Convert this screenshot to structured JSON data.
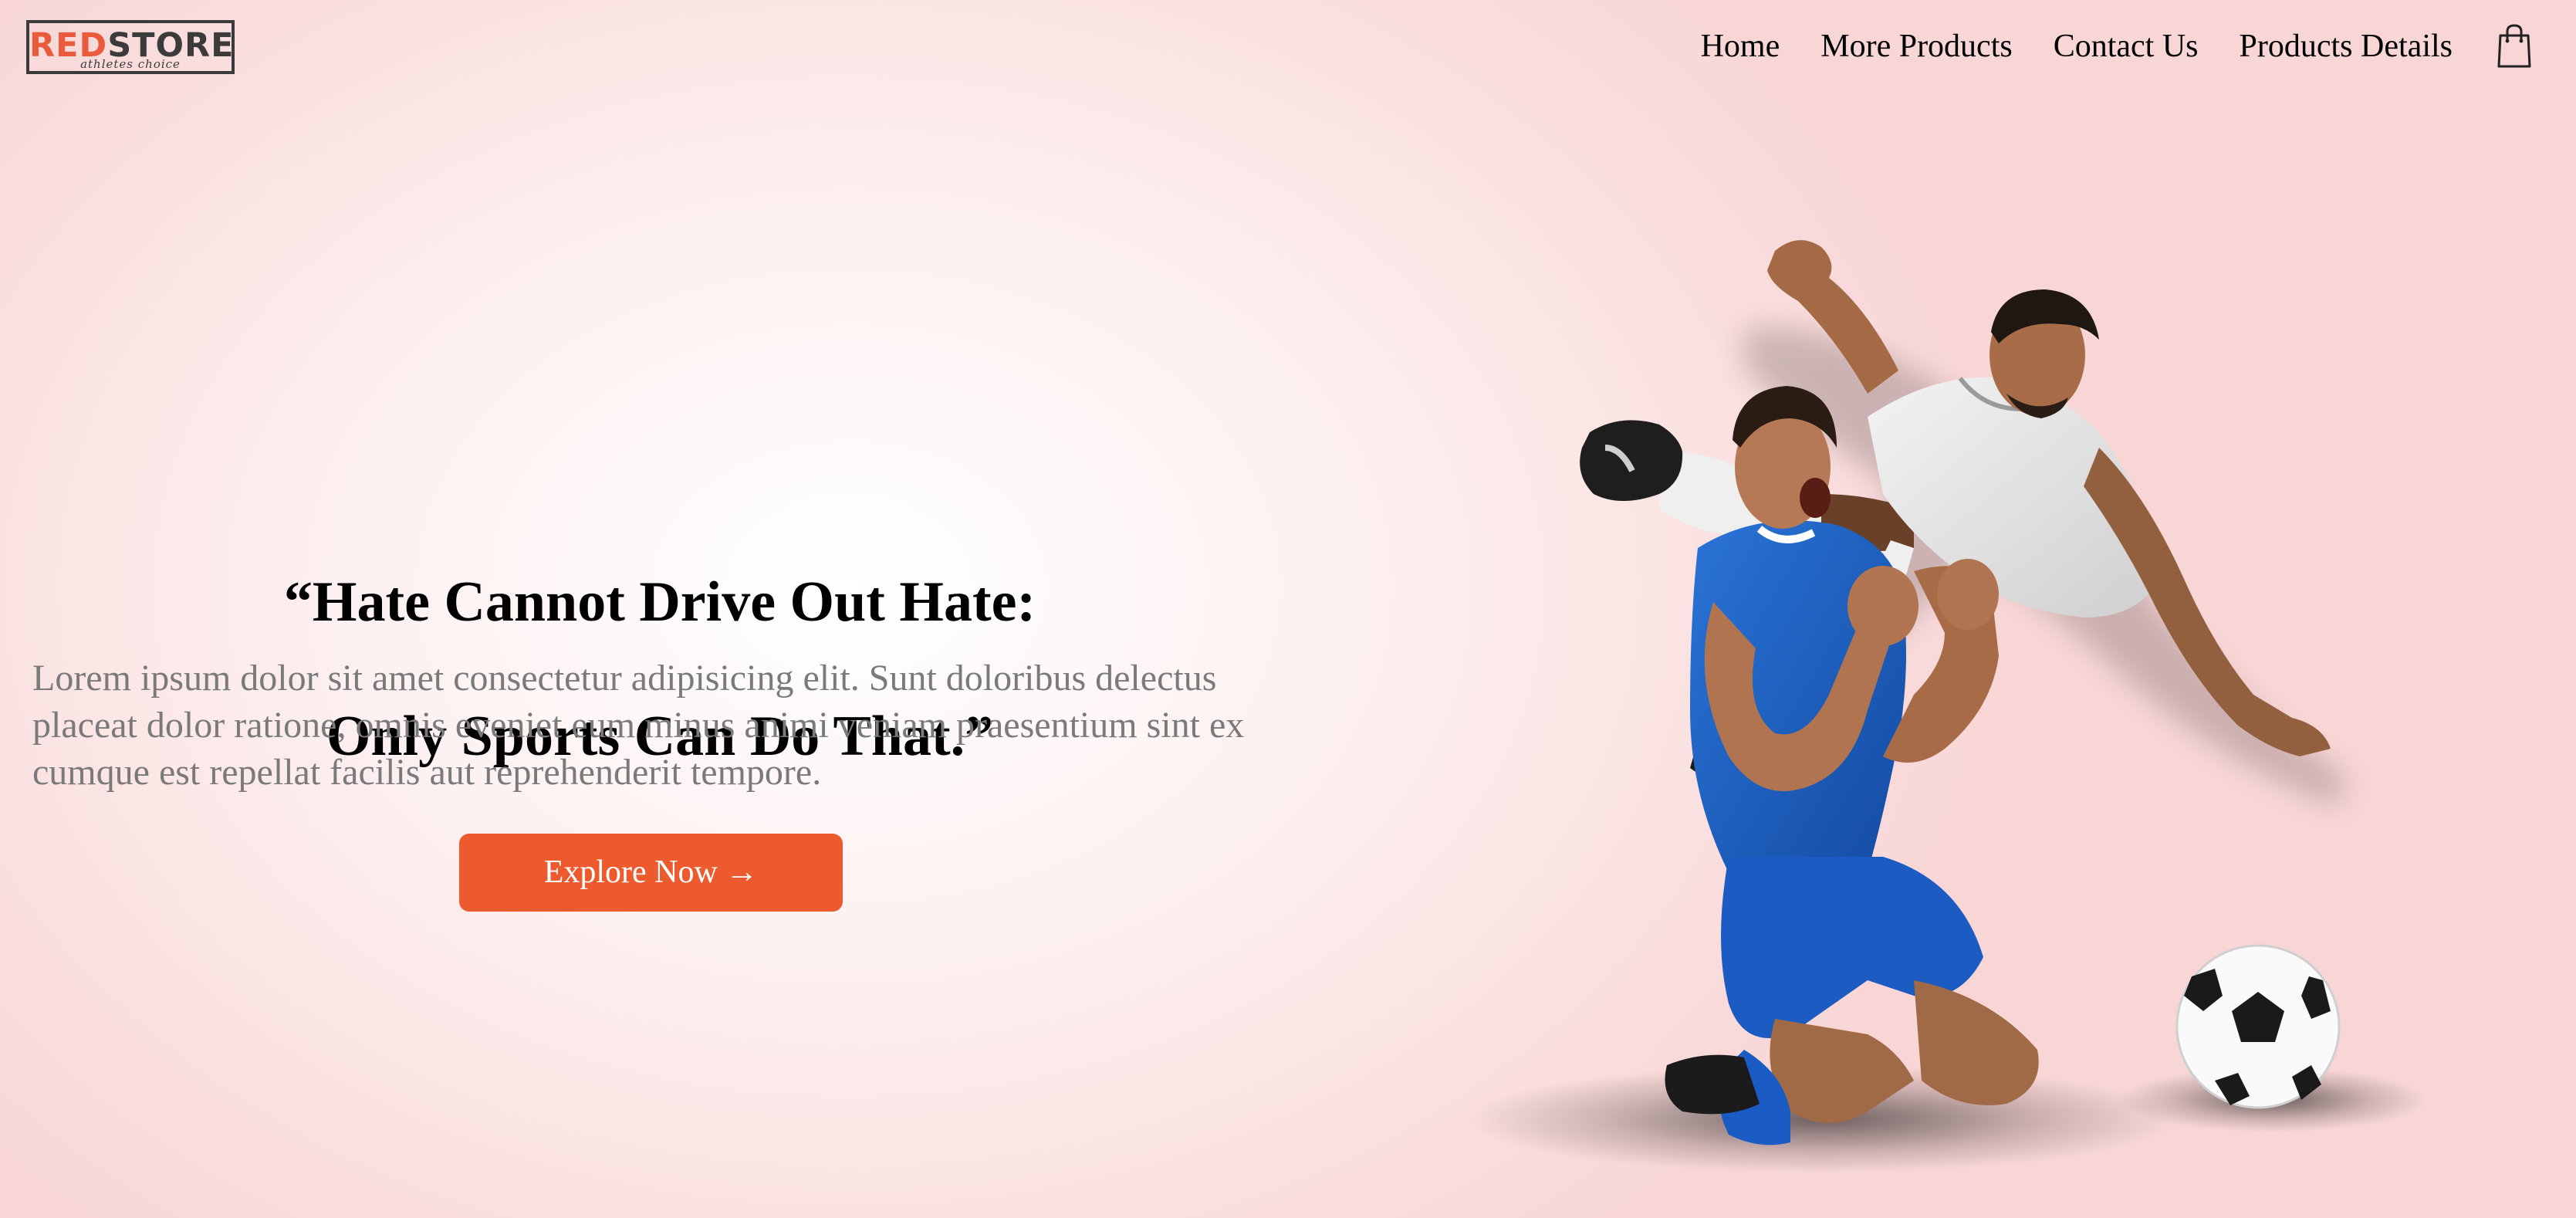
{
  "brand": {
    "name_red": "RED",
    "name_dark": "STORE",
    "tagline": "athletes choice"
  },
  "nav": {
    "items": [
      {
        "label": "Home"
      },
      {
        "label": "More Products"
      },
      {
        "label": "Contact Us"
      },
      {
        "label": "Products Details"
      }
    ],
    "cart_icon": "shopping-bag-icon"
  },
  "hero": {
    "headline_line1": "“Hate Cannot Drive Out Hate:",
    "headline_line2": "Only Sports Can Do That.”",
    "paragraph": "Lorem ipsum dolor sit amet consectetur adipisicing elit. Sunt doloribus delectus placeat dolor ratione, omnis eveniet eum minus animi veniam praesentium sint ex cumque est repellat facilis aut reprehenderit tempore.",
    "cta_label": "Explore Now →",
    "image_icon": "soccer-players-illustration"
  },
  "colors": {
    "accent": "#ec5a2d",
    "logo_red": "#ea5b3e",
    "logo_dark": "#3b3b3b",
    "text_muted": "#7a7a7a",
    "kit_blue": "#1e5fbf",
    "kit_white": "#e9e9e9"
  }
}
